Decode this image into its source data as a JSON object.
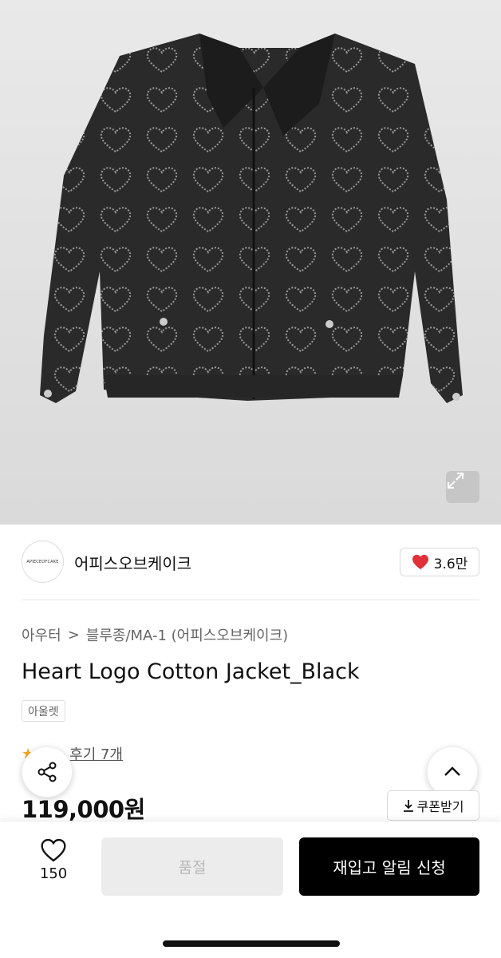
{
  "product_image": {
    "alt": ""
  },
  "brand": {
    "logo_text": "APIECEOFCAKE",
    "name": "어피스오브케이크"
  },
  "likes": {
    "count": "3.6만"
  },
  "breadcrumb": {
    "level1": "아우터",
    "separator": ">",
    "level2": "블루종/MA-1 (어피스오브케이크)"
  },
  "product": {
    "title": "Heart Logo Cotton Jacket_Black",
    "tag": "아울렛",
    "price": "119,000원"
  },
  "review": {
    "text": "후기 7개"
  },
  "coupon": {
    "label": "쿠폰받기"
  },
  "bottom": {
    "wish_count": "150",
    "soldout_label": "품절",
    "restock_label": "재입고 알림 신청"
  },
  "icons": {
    "expand": "expand-icon",
    "heart": "heart-icon",
    "share": "share-icon",
    "chevron_up": "chevron-up-icon",
    "download": "download-icon",
    "star": "star-icon"
  },
  "colors": {
    "heart_red": "#e0303a",
    "button_black": "#000000",
    "disabled_bg": "#ececec"
  }
}
